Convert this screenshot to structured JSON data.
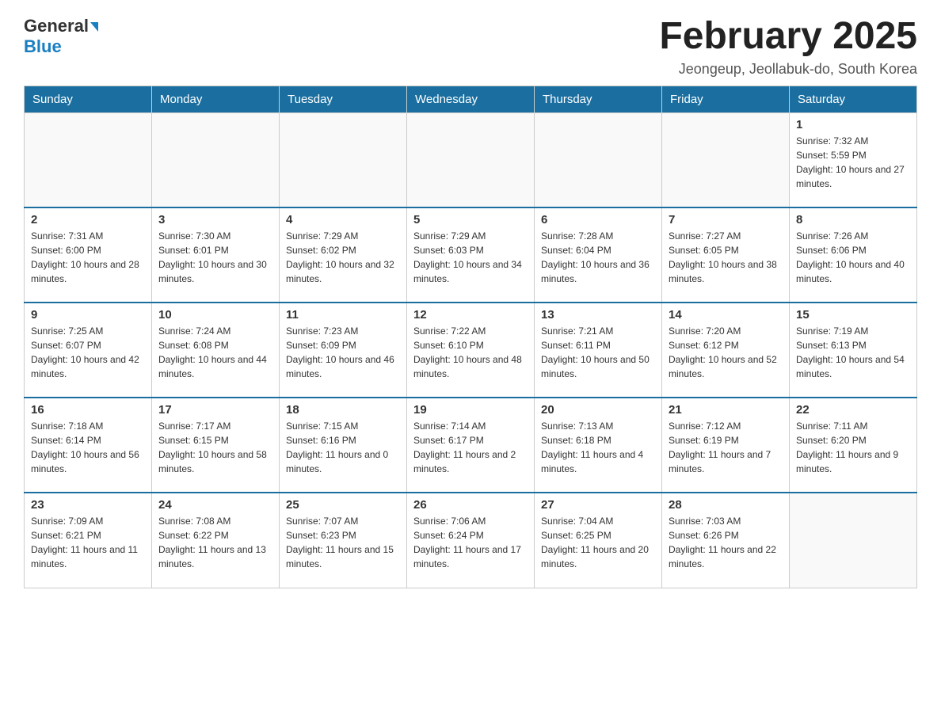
{
  "header": {
    "logo_general": "General",
    "logo_blue": "Blue",
    "month_title": "February 2025",
    "location": "Jeongeup, Jeollabuk-do, South Korea"
  },
  "days_of_week": [
    "Sunday",
    "Monday",
    "Tuesday",
    "Wednesday",
    "Thursday",
    "Friday",
    "Saturday"
  ],
  "weeks": [
    [
      {
        "day": "",
        "info": ""
      },
      {
        "day": "",
        "info": ""
      },
      {
        "day": "",
        "info": ""
      },
      {
        "day": "",
        "info": ""
      },
      {
        "day": "",
        "info": ""
      },
      {
        "day": "",
        "info": ""
      },
      {
        "day": "1",
        "info": "Sunrise: 7:32 AM\nSunset: 5:59 PM\nDaylight: 10 hours and 27 minutes."
      }
    ],
    [
      {
        "day": "2",
        "info": "Sunrise: 7:31 AM\nSunset: 6:00 PM\nDaylight: 10 hours and 28 minutes."
      },
      {
        "day": "3",
        "info": "Sunrise: 7:30 AM\nSunset: 6:01 PM\nDaylight: 10 hours and 30 minutes."
      },
      {
        "day": "4",
        "info": "Sunrise: 7:29 AM\nSunset: 6:02 PM\nDaylight: 10 hours and 32 minutes."
      },
      {
        "day": "5",
        "info": "Sunrise: 7:29 AM\nSunset: 6:03 PM\nDaylight: 10 hours and 34 minutes."
      },
      {
        "day": "6",
        "info": "Sunrise: 7:28 AM\nSunset: 6:04 PM\nDaylight: 10 hours and 36 minutes."
      },
      {
        "day": "7",
        "info": "Sunrise: 7:27 AM\nSunset: 6:05 PM\nDaylight: 10 hours and 38 minutes."
      },
      {
        "day": "8",
        "info": "Sunrise: 7:26 AM\nSunset: 6:06 PM\nDaylight: 10 hours and 40 minutes."
      }
    ],
    [
      {
        "day": "9",
        "info": "Sunrise: 7:25 AM\nSunset: 6:07 PM\nDaylight: 10 hours and 42 minutes."
      },
      {
        "day": "10",
        "info": "Sunrise: 7:24 AM\nSunset: 6:08 PM\nDaylight: 10 hours and 44 minutes."
      },
      {
        "day": "11",
        "info": "Sunrise: 7:23 AM\nSunset: 6:09 PM\nDaylight: 10 hours and 46 minutes."
      },
      {
        "day": "12",
        "info": "Sunrise: 7:22 AM\nSunset: 6:10 PM\nDaylight: 10 hours and 48 minutes."
      },
      {
        "day": "13",
        "info": "Sunrise: 7:21 AM\nSunset: 6:11 PM\nDaylight: 10 hours and 50 minutes."
      },
      {
        "day": "14",
        "info": "Sunrise: 7:20 AM\nSunset: 6:12 PM\nDaylight: 10 hours and 52 minutes."
      },
      {
        "day": "15",
        "info": "Sunrise: 7:19 AM\nSunset: 6:13 PM\nDaylight: 10 hours and 54 minutes."
      }
    ],
    [
      {
        "day": "16",
        "info": "Sunrise: 7:18 AM\nSunset: 6:14 PM\nDaylight: 10 hours and 56 minutes."
      },
      {
        "day": "17",
        "info": "Sunrise: 7:17 AM\nSunset: 6:15 PM\nDaylight: 10 hours and 58 minutes."
      },
      {
        "day": "18",
        "info": "Sunrise: 7:15 AM\nSunset: 6:16 PM\nDaylight: 11 hours and 0 minutes."
      },
      {
        "day": "19",
        "info": "Sunrise: 7:14 AM\nSunset: 6:17 PM\nDaylight: 11 hours and 2 minutes."
      },
      {
        "day": "20",
        "info": "Sunrise: 7:13 AM\nSunset: 6:18 PM\nDaylight: 11 hours and 4 minutes."
      },
      {
        "day": "21",
        "info": "Sunrise: 7:12 AM\nSunset: 6:19 PM\nDaylight: 11 hours and 7 minutes."
      },
      {
        "day": "22",
        "info": "Sunrise: 7:11 AM\nSunset: 6:20 PM\nDaylight: 11 hours and 9 minutes."
      }
    ],
    [
      {
        "day": "23",
        "info": "Sunrise: 7:09 AM\nSunset: 6:21 PM\nDaylight: 11 hours and 11 minutes."
      },
      {
        "day": "24",
        "info": "Sunrise: 7:08 AM\nSunset: 6:22 PM\nDaylight: 11 hours and 13 minutes."
      },
      {
        "day": "25",
        "info": "Sunrise: 7:07 AM\nSunset: 6:23 PM\nDaylight: 11 hours and 15 minutes."
      },
      {
        "day": "26",
        "info": "Sunrise: 7:06 AM\nSunset: 6:24 PM\nDaylight: 11 hours and 17 minutes."
      },
      {
        "day": "27",
        "info": "Sunrise: 7:04 AM\nSunset: 6:25 PM\nDaylight: 11 hours and 20 minutes."
      },
      {
        "day": "28",
        "info": "Sunrise: 7:03 AM\nSunset: 6:26 PM\nDaylight: 11 hours and 22 minutes."
      },
      {
        "day": "",
        "info": ""
      }
    ]
  ]
}
